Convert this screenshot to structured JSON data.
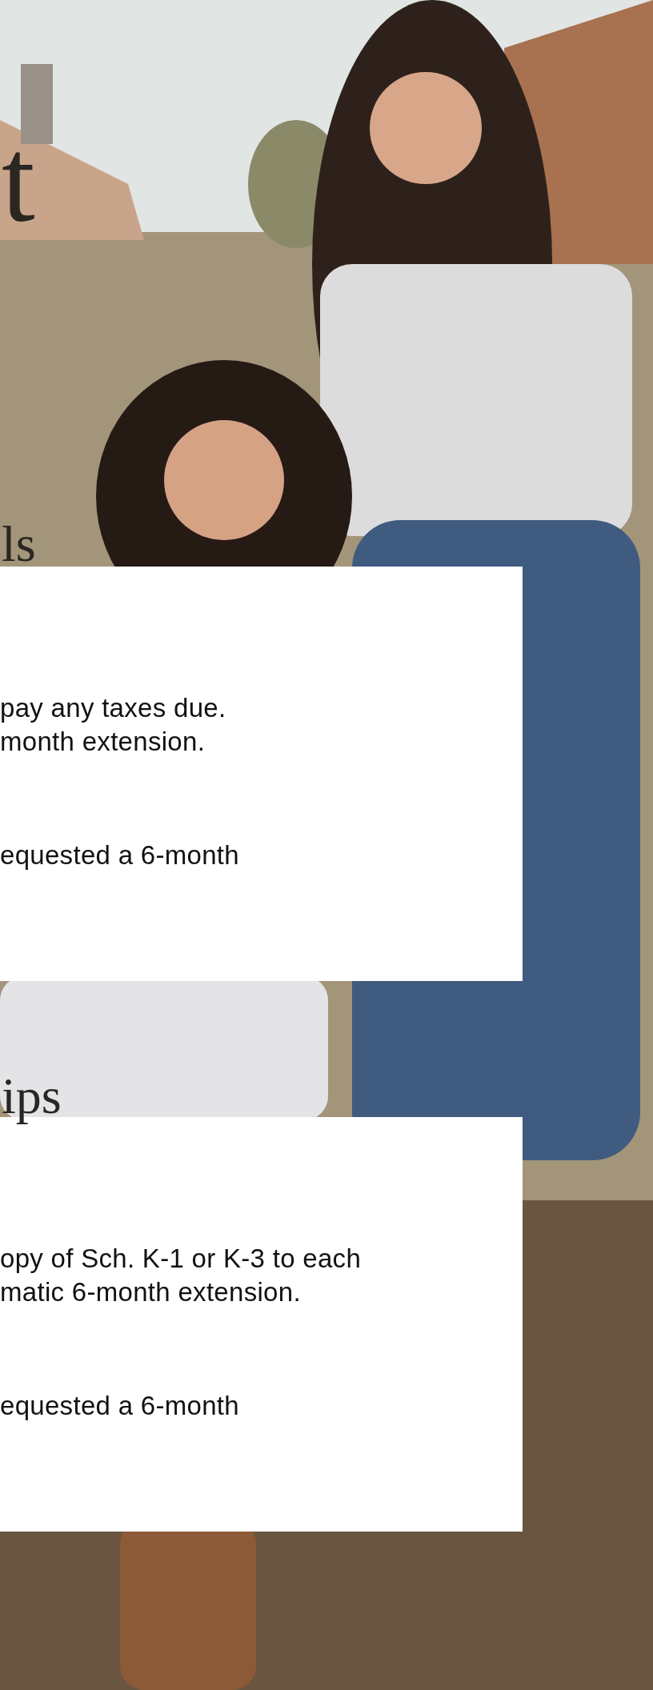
{
  "hero": {
    "heading": "t"
  },
  "sections": [
    {
      "heading": "ls",
      "paragraphs": [
        "pay any taxes due.\nmonth extension.",
        "equested a 6-month"
      ]
    },
    {
      "heading": "ips",
      "paragraphs": [
        "opy of Sch. K-1 or K-3 to each\nmatic 6-month extension.",
        "equested a 6-month"
      ]
    }
  ]
}
